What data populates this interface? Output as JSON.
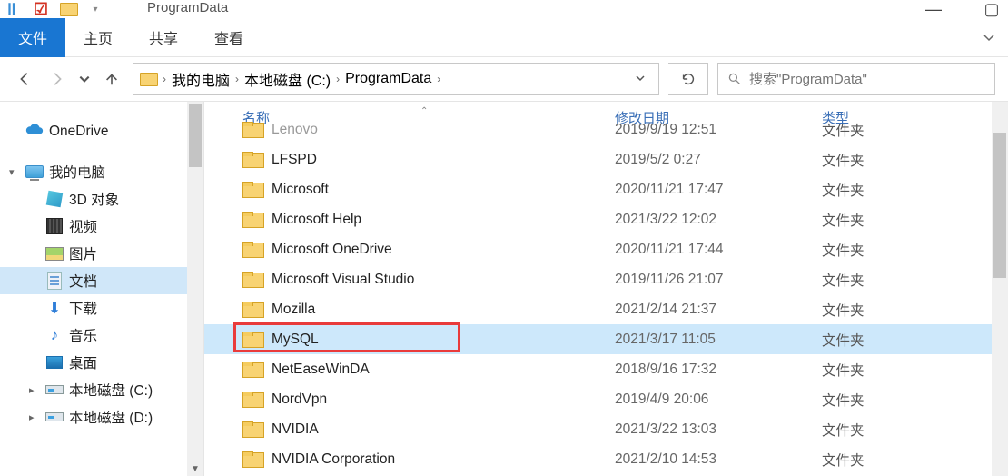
{
  "window": {
    "title": "ProgramData"
  },
  "ribbon": {
    "file_tab": "文件",
    "tabs": [
      "主页",
      "共享",
      "查看"
    ]
  },
  "nav": {
    "breadcrumb": [
      "我的电脑",
      "本地磁盘 (C:)",
      "ProgramData"
    ]
  },
  "search": {
    "placeholder": "搜索\"ProgramData\""
  },
  "sidebar": {
    "items": [
      {
        "label": "OneDrive",
        "icon": "cloud",
        "indent": 0,
        "chev": ""
      },
      {
        "label": "我的电脑",
        "icon": "pc",
        "indent": 0,
        "chev": "▾"
      },
      {
        "label": "3D 对象",
        "icon": "cube",
        "indent": 1,
        "chev": ""
      },
      {
        "label": "视频",
        "icon": "video",
        "indent": 1,
        "chev": ""
      },
      {
        "label": "图片",
        "icon": "picture",
        "indent": 1,
        "chev": ""
      },
      {
        "label": "文档",
        "icon": "doc",
        "indent": 1,
        "chev": "",
        "selected": true
      },
      {
        "label": "下载",
        "icon": "download",
        "indent": 1,
        "chev": ""
      },
      {
        "label": "音乐",
        "icon": "music",
        "indent": 1,
        "chev": ""
      },
      {
        "label": "桌面",
        "icon": "desktop",
        "indent": 1,
        "chev": ""
      },
      {
        "label": "本地磁盘 (C:)",
        "icon": "drive",
        "indent": 1,
        "chev": "▸"
      },
      {
        "label": "本地磁盘 (D:)",
        "icon": "drive",
        "indent": 1,
        "chev": "▸"
      }
    ]
  },
  "columns": {
    "name": "名称",
    "date": "修改日期",
    "type": "类型"
  },
  "files": [
    {
      "name": "Lenovo",
      "date": "2019/9/19 12:51",
      "type": "文件夹",
      "cut": true
    },
    {
      "name": "LFSPD",
      "date": "2019/5/2 0:27",
      "type": "文件夹"
    },
    {
      "name": "Microsoft",
      "date": "2020/11/21 17:47",
      "type": "文件夹"
    },
    {
      "name": "Microsoft Help",
      "date": "2021/3/22 12:02",
      "type": "文件夹"
    },
    {
      "name": "Microsoft OneDrive",
      "date": "2020/11/21 17:44",
      "type": "文件夹"
    },
    {
      "name": "Microsoft Visual Studio",
      "date": "2019/11/26 21:07",
      "type": "文件夹"
    },
    {
      "name": "Mozilla",
      "date": "2021/2/14 21:37",
      "type": "文件夹"
    },
    {
      "name": "MySQL",
      "date": "2021/3/17 11:05",
      "type": "文件夹",
      "selected": true,
      "highlighted": true
    },
    {
      "name": "NetEaseWinDA",
      "date": "2018/9/16 17:32",
      "type": "文件夹"
    },
    {
      "name": "NordVpn",
      "date": "2019/4/9 20:06",
      "type": "文件夹"
    },
    {
      "name": "NVIDIA",
      "date": "2021/3/22 13:03",
      "type": "文件夹"
    },
    {
      "name": "NVIDIA Corporation",
      "date": "2021/2/10 14:53",
      "type": "文件夹"
    }
  ]
}
